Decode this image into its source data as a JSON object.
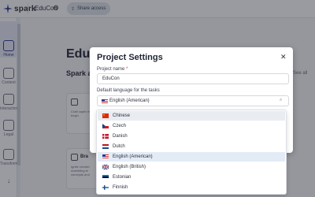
{
  "topbar": {
    "logo_text": "spark",
    "project_name": "EduCon",
    "share_label": "Share access"
  },
  "sidebar": {
    "items": [
      {
        "label": "Home",
        "icon": "home-icon",
        "active": true
      },
      {
        "label": "Content",
        "icon": "content-icon",
        "active": false
      },
      {
        "label": "Interaction",
        "icon": "interaction-icon",
        "active": false
      },
      {
        "label": "Legal",
        "icon": "legal-icon",
        "active": false
      },
      {
        "label": "Transform",
        "icon": "transform-icon",
        "active": false
      }
    ]
  },
  "page": {
    "title": "EduCon",
    "subtitle": "Spark a n",
    "see_all": "See all",
    "card1_text": "Craft captiv from begin",
    "card2_title": "Bra",
    "card2_text": "Ignite creativi marketing te concepts and"
  },
  "modal": {
    "title": "Project Settings",
    "close_icon": "close-icon",
    "project_name_label": "Project name",
    "project_name_required": "*",
    "project_name_value": "EduCon",
    "language_label": "Default language for the tasks",
    "language_value": "English (American)"
  },
  "dropdown": {
    "options": [
      {
        "label": "Chinese",
        "flag": "cn",
        "state": "highlight"
      },
      {
        "label": "Czech",
        "flag": "cz",
        "state": ""
      },
      {
        "label": "Danish",
        "flag": "dk",
        "state": ""
      },
      {
        "label": "Dutch",
        "flag": "nl",
        "state": ""
      },
      {
        "label": "English (American)",
        "flag": "us",
        "state": "selected"
      },
      {
        "label": "English (British)",
        "flag": "gb",
        "state": ""
      },
      {
        "label": "Estonian",
        "flag": "ee",
        "state": ""
      },
      {
        "label": "Finnish",
        "flag": "fi",
        "state": ""
      }
    ]
  },
  "colors": {
    "accent": "#2d3a8c",
    "overlay": "#1e222c",
    "required": "#d23a3a"
  }
}
